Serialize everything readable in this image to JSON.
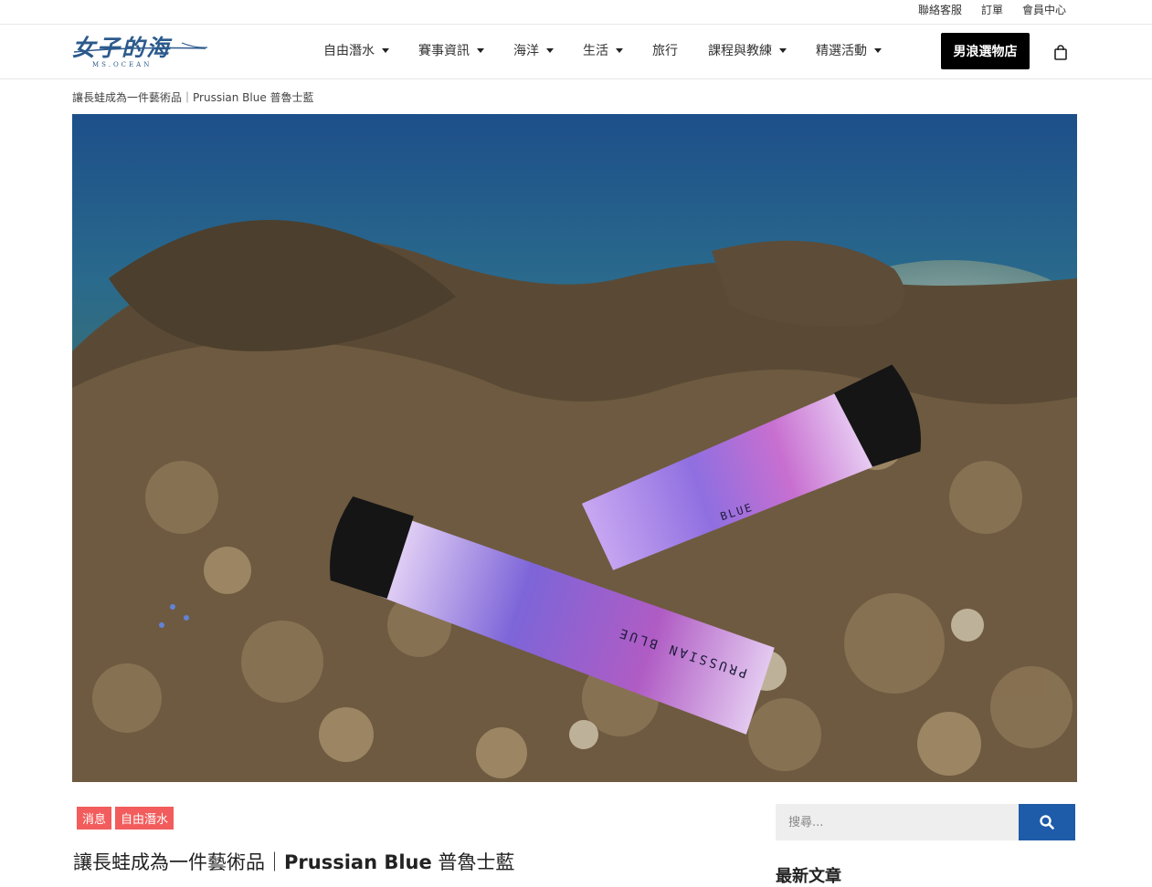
{
  "topbar": {
    "links": [
      "聯絡客服",
      "訂單",
      "會員中心"
    ]
  },
  "logo": {
    "chinese": "女子的海",
    "english": "MS.OCEAN"
  },
  "nav": {
    "items": [
      {
        "label": "自由潛水",
        "dropdown": true
      },
      {
        "label": "賽事資訊",
        "dropdown": true
      },
      {
        "label": "海洋",
        "dropdown": true
      },
      {
        "label": "生活",
        "dropdown": true
      },
      {
        "label": "旅行",
        "dropdown": false
      },
      {
        "label": "課程與教練",
        "dropdown": true
      },
      {
        "label": "精選活動",
        "dropdown": true
      }
    ],
    "shop_label": "男浪選物店"
  },
  "breadcrumb": "讓長蛙成為一件藝術品｜Prussian Blue 普魯士藍",
  "hero": {
    "fin_text": "PRUSSIAN BLUE",
    "fin_text_short": "BLUE"
  },
  "post": {
    "tags": [
      "消息",
      "自由潛水"
    ],
    "title_cn": "讓長蛙成為一件藝術品｜",
    "title_en": "Prussian Blue",
    "title_suffix": " 普魯士藍"
  },
  "sidebar": {
    "search_placeholder": "搜尋...",
    "latest_heading": "最新文章"
  },
  "colors": {
    "tag": "#f25c5c",
    "search_button": "#1e5ba8",
    "logo": "#2c5a8c",
    "shop_button": "#000000"
  }
}
